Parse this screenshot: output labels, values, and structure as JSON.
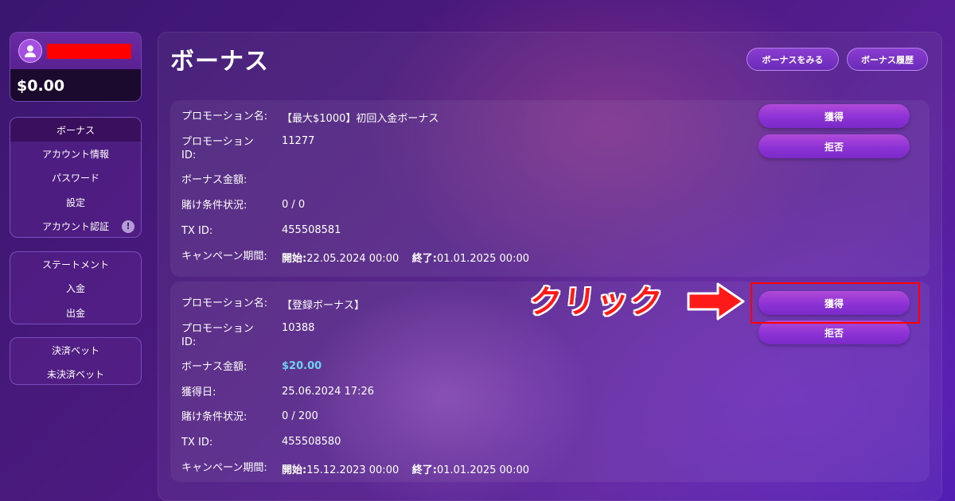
{
  "sidebar": {
    "balance": "$0.00",
    "menu1": [
      "ボーナス",
      "アカウント情報",
      "パスワード",
      "設定",
      "アカウント認証"
    ],
    "menu1_badge": "!",
    "menu2": [
      "ステートメント",
      "入金",
      "出金"
    ],
    "menu3": [
      "決済ベット",
      "未決済ベット"
    ]
  },
  "header": {
    "title": "ボーナス",
    "view_bonus": "ボーナスをみる",
    "bonus_history": "ボーナス履歴"
  },
  "promos": [
    {
      "name_label": "プロモーション名:",
      "name": "【最大$1000】初回入金ボーナス",
      "id_label": "プロモーション ID:",
      "id": "11277",
      "amount_label": "ボーナス金額:",
      "amount": "",
      "wager_label": "賭け条件状況:",
      "wager": "0 / 0",
      "tx_label": "TX ID:",
      "tx": "455508581",
      "period_label": "キャンペーン期間:",
      "start_label": "開始:",
      "start": "22.05.2024 00:00",
      "end_label": "終了:",
      "end": "01.01.2025 00:00",
      "accept": "獲得",
      "decline": "拒否"
    },
    {
      "name_label": "プロモーション名:",
      "name": "【登録ボーナス】",
      "id_label": "プロモーション ID:",
      "id": "10388",
      "amount_label": "ボーナス金額:",
      "amount": "$20.00",
      "date_label": "獲得日:",
      "date": "25.06.2024 17:26",
      "wager_label": "賭け条件状況:",
      "wager": "0 / 200",
      "tx_label": "TX ID:",
      "tx": "455508580",
      "period_label": "キャンペーン期間:",
      "start_label": "開始:",
      "start": "15.12.2023 00:00",
      "end_label": "終了:",
      "end": "01.01.2025 00:00",
      "accept": "獲得",
      "decline": "拒否"
    }
  ],
  "annotation": {
    "text": "クリック"
  },
  "colors": {
    "highlight": "#ff0000",
    "amount": "#6fd1f0"
  }
}
